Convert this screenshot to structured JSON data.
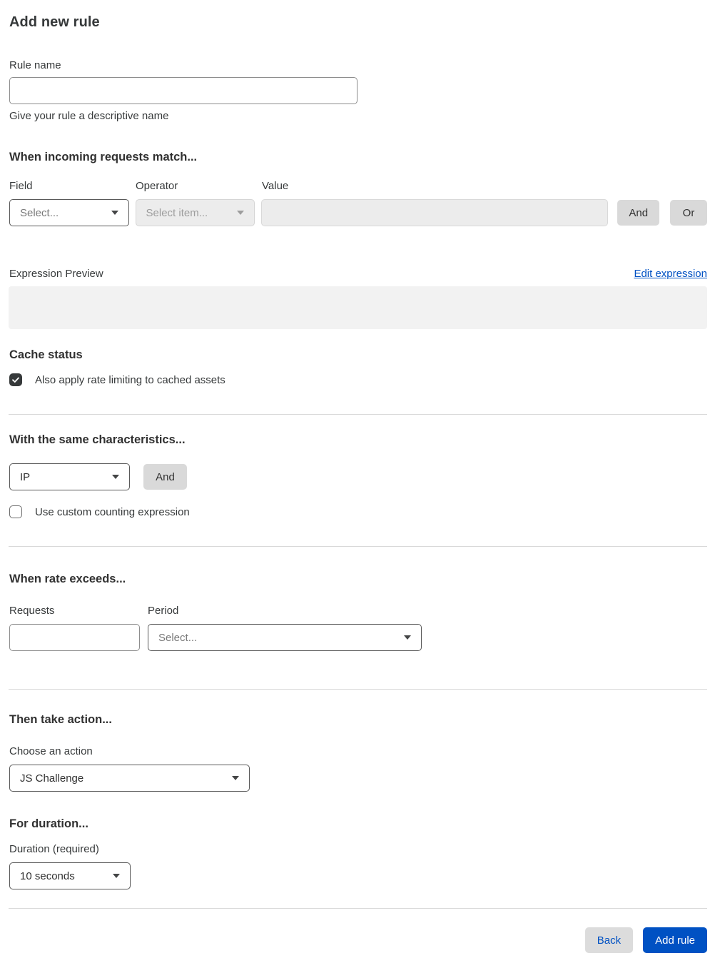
{
  "page": {
    "title": "Add new rule"
  },
  "colors": {
    "accent_blue": "#0051c3",
    "checkbox_checked": "#36393a",
    "button_gray": "#d9d9d9"
  },
  "rule_name": {
    "label": "Rule name",
    "value": "",
    "helper": "Give your rule a descriptive name"
  },
  "match": {
    "heading": "When incoming requests match...",
    "field": {
      "label": "Field",
      "value": "Select...",
      "is_placeholder": true
    },
    "operator": {
      "label": "Operator",
      "value": "Select item...",
      "is_placeholder": true,
      "disabled": true
    },
    "value": {
      "label": "Value",
      "value": "",
      "disabled": true
    },
    "and_button": "And",
    "or_button": "Or"
  },
  "expression": {
    "label": "Expression Preview",
    "edit_link": "Edit expression",
    "preview_value": ""
  },
  "cache_status": {
    "heading": "Cache status",
    "checkbox_label": "Also apply rate limiting to cached assets",
    "checked": true
  },
  "characteristics": {
    "heading": "With the same characteristics...",
    "select_value": "IP",
    "and_button": "And",
    "checkbox_label": "Use custom counting expression",
    "checked": false
  },
  "rate": {
    "heading": "When rate exceeds...",
    "requests": {
      "label": "Requests",
      "value": ""
    },
    "period": {
      "label": "Period",
      "value": "Select...",
      "is_placeholder": true
    }
  },
  "action": {
    "heading": "Then take action...",
    "choose_label": "Choose an action",
    "value": "JS Challenge"
  },
  "duration": {
    "heading": "For duration...",
    "label": "Duration (required)",
    "value": "10 seconds"
  },
  "footer": {
    "back_button": "Back",
    "submit_button": "Add rule"
  }
}
